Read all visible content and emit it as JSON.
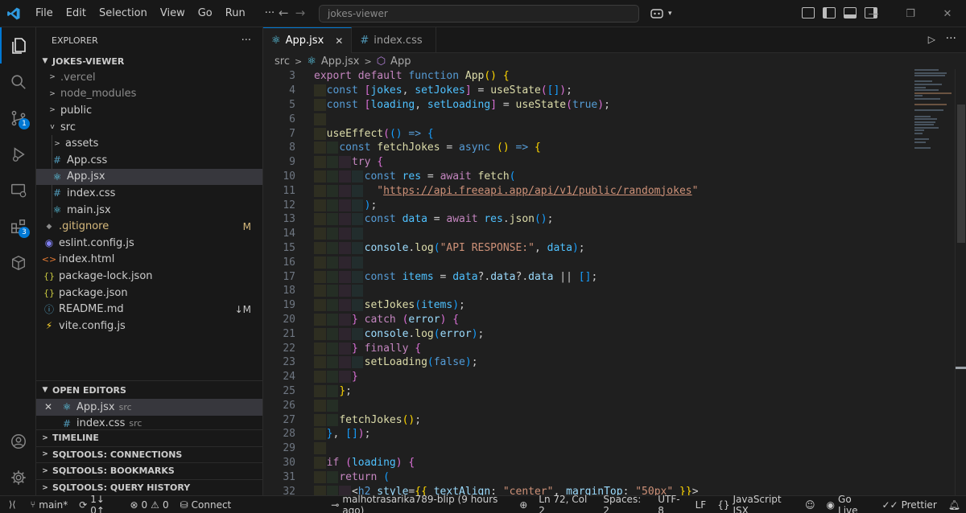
{
  "titlebar": {
    "menu": [
      "File",
      "Edit",
      "Selection",
      "View",
      "Go",
      "Run",
      "···"
    ],
    "search_text": "jokes-viewer"
  },
  "activity": {
    "scm_badge": "1",
    "extensions_badge": "3"
  },
  "explorer": {
    "title": "EXPLORER",
    "more": "···",
    "project": "JOKES-VIEWER",
    "items": [
      {
        "label": ".vercel",
        "kind": "folder",
        "dim": true
      },
      {
        "label": "node_modules",
        "kind": "folder",
        "dim": true
      },
      {
        "label": "public",
        "kind": "folder"
      },
      {
        "label": "src",
        "kind": "folder-open"
      },
      {
        "label": "assets",
        "kind": "folder"
      },
      {
        "label": "App.css",
        "kind": "css"
      },
      {
        "label": "App.jsx",
        "kind": "react"
      },
      {
        "label": "index.css",
        "kind": "css"
      },
      {
        "label": "main.jsx",
        "kind": "react"
      },
      {
        "label": ".gitignore",
        "kind": "git",
        "status": "M"
      },
      {
        "label": "eslint.config.js",
        "kind": "eslint"
      },
      {
        "label": "index.html",
        "kind": "html"
      },
      {
        "label": "package-lock.json",
        "kind": "json"
      },
      {
        "label": "package.json",
        "kind": "json"
      },
      {
        "label": "README.md",
        "kind": "md",
        "status": "↓M"
      },
      {
        "label": "vite.config.js",
        "kind": "vite"
      }
    ]
  },
  "open_editors": {
    "title": "OPEN EDITORS",
    "items": [
      {
        "label": "App.jsx",
        "dir": "src"
      },
      {
        "label": "index.css",
        "dir": "src"
      }
    ]
  },
  "panels": [
    "TIMELINE",
    "SQLTOOLS: CONNECTIONS",
    "SQLTOOLS: BOOKMARKS",
    "SQLTOOLS: QUERY HISTORY"
  ],
  "tabs": [
    {
      "label": "App.jsx",
      "close": "✕"
    },
    {
      "label": "index.css"
    }
  ],
  "breadcrumb": [
    "src",
    "App.jsx",
    "App"
  ],
  "code": {
    "line_numbers": [
      "3",
      "4",
      "5",
      "6",
      "7",
      "8",
      "9",
      "10",
      "11",
      "12",
      "13",
      "14",
      "15",
      "16",
      "17",
      "18",
      "19",
      "20",
      "21",
      "22",
      "23",
      "24",
      "25",
      "26",
      "27",
      "28",
      "29",
      "30",
      "31",
      "32"
    ]
  },
  "statusbar": {
    "branch": "main*",
    "sync": "1↓ 0↑",
    "errors": "0",
    "warnings": "0",
    "connect": "Connect",
    "blame": "malhotrasarika789-blip (9 hours ago)",
    "position": "Ln 72, Col 2",
    "spaces": "Spaces: 2",
    "encoding": "UTF-8",
    "eol": "LF",
    "language": "JavaScript JSX",
    "golive": "Go Live",
    "prettier": "Prettier"
  }
}
